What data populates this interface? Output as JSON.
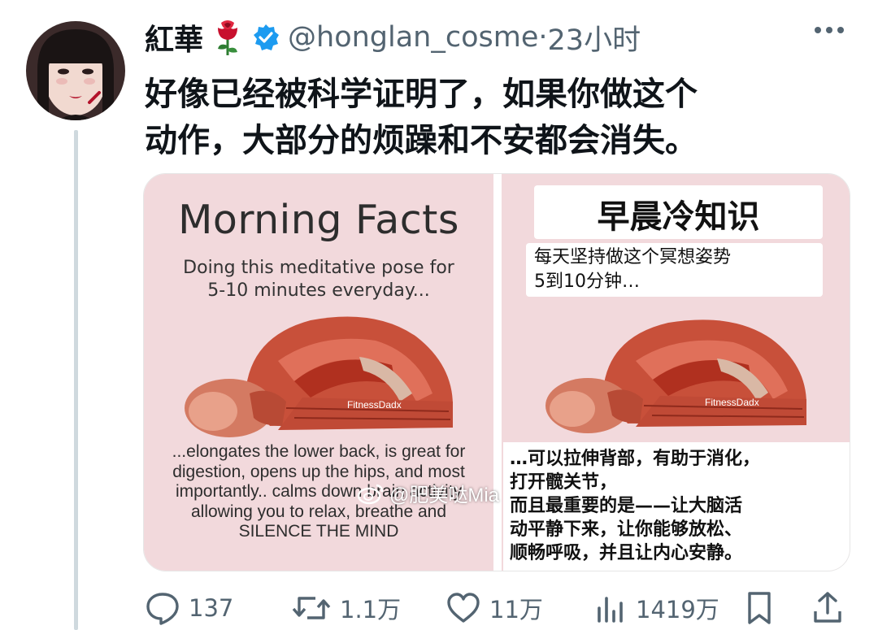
{
  "post": {
    "display_name": "紅華",
    "handle": "@honglan_cosme",
    "dot": "·",
    "time": "23小时",
    "text_lines": [
      "好像已经被科学证明了，如果你做这个",
      "动作，大部分的烦躁和不安都会消失。"
    ]
  },
  "media": {
    "left": {
      "title": "Morning Facts",
      "subtitle_lines": [
        "Doing this meditative pose for",
        "5-10 minutes everyday..."
      ],
      "credit": "FitnessDadx",
      "body_lines": [
        "...elongates the lower back, is great for",
        "digestion, opens up the hips, and most",
        "importantly.. calms down brain activity",
        "allowing you to relax, breathe and",
        "SILENCE THE MIND"
      ]
    },
    "right": {
      "title": "早晨冷知识",
      "subtitle_lines": [
        "每天坚持做这个冥想姿势",
        "5到10分钟…"
      ],
      "credit": "FitnessDadx",
      "body_lines": [
        "…可以拉伸背部，有助于消化，",
        "打开髋关节，",
        "而且最重要的是——让大脑活",
        "动平静下来，让你能够放松、",
        "顺畅呼吸，并且让内心安静。"
      ]
    },
    "watermark": "@肥美哒Mia"
  },
  "actions": {
    "reply_count": "137",
    "retweet_count": "1.1万",
    "like_count": "11万",
    "views_count": "1419万"
  },
  "icons": [
    "rose-icon",
    "verified-icon",
    "more-icon",
    "reply-icon",
    "retweet-icon",
    "like-icon",
    "views-icon",
    "bookmark-icon",
    "share-icon",
    "weibo-icon"
  ],
  "colors": {
    "verified": "#1d9bf0",
    "muted_text": "#536471",
    "card_pink": "#f2d9dc",
    "rose_red": "#c8102e"
  }
}
